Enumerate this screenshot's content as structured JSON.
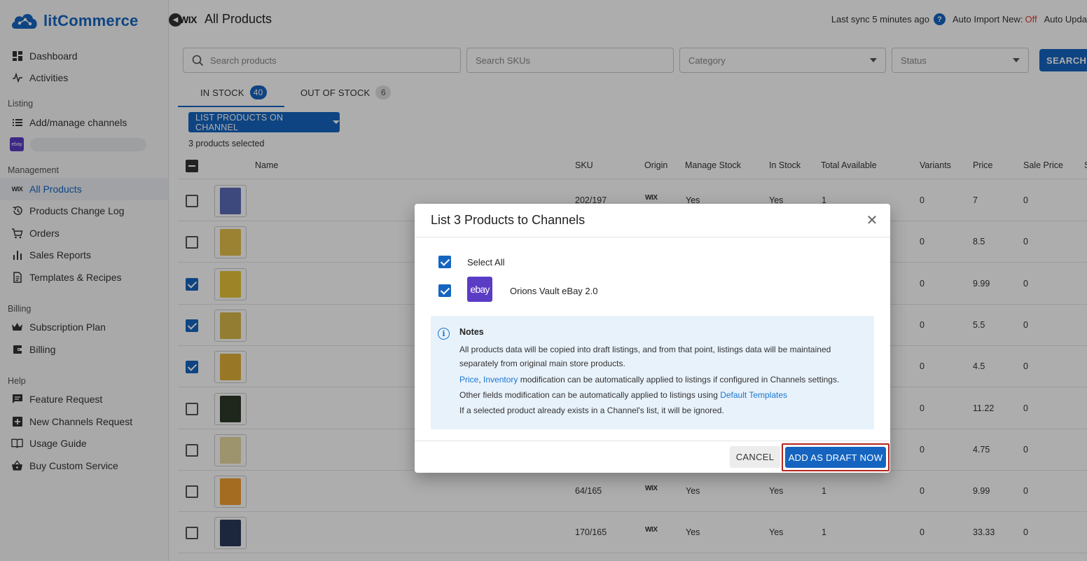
{
  "app": {
    "name": "litCommerce"
  },
  "sidebar": {
    "items_top": [
      {
        "label": "Dashboard",
        "icon": "dashboard-icon"
      },
      {
        "label": "Activities",
        "icon": "activity-icon"
      }
    ],
    "section_listing": "Listing",
    "listing_items": [
      {
        "label": "Add/manage channels",
        "icon": "list-icon"
      }
    ],
    "ebay_channel_mini": "ebay",
    "section_management": "Management",
    "management_items": [
      {
        "label": "All Products",
        "icon": "wix-icon",
        "active": true
      },
      {
        "label": "Products Change Log",
        "icon": "history-icon"
      },
      {
        "label": "Orders",
        "icon": "cart-icon"
      },
      {
        "label": "Sales Reports",
        "icon": "bar-chart-icon"
      },
      {
        "label": "Templates & Recipes",
        "icon": "document-icon"
      }
    ],
    "section_billing": "Billing",
    "billing_items": [
      {
        "label": "Subscription Plan",
        "icon": "crown-icon"
      },
      {
        "label": "Billing",
        "icon": "wallet-icon"
      }
    ],
    "section_help": "Help",
    "help_items": [
      {
        "label": "Feature Request",
        "icon": "feedback-icon"
      },
      {
        "label": "New Channels Request",
        "icon": "add-box-icon"
      },
      {
        "label": "Usage Guide",
        "icon": "book-icon"
      },
      {
        "label": "Buy Custom Service",
        "icon": "basket-icon"
      }
    ]
  },
  "header": {
    "store_logo": "WIX",
    "title": "All Products",
    "last_sync": "Last sync 5 minutes ago",
    "auto_import_label": "Auto Import New:",
    "auto_import_value": "Off",
    "auto_update_label": "Auto Upda"
  },
  "filters": {
    "search_placeholder": "Search products",
    "sku_placeholder": "Search SKUs",
    "category_placeholder": "Category",
    "status_placeholder": "Status",
    "search_button": "SEARCH"
  },
  "tabs": [
    {
      "label": "IN STOCK",
      "count": "40"
    },
    {
      "label": "OUT OF STOCK",
      "count": "6"
    }
  ],
  "list_button": "LIST PRODUCTS ON CHANNEL",
  "selected_text": "3 products selected",
  "table": {
    "columns": [
      "Name",
      "SKU",
      "Origin",
      "Manage Stock",
      "In Stock",
      "Total Available",
      "Variants",
      "Price",
      "Sale Price",
      "S"
    ],
    "rows": [
      {
        "checked": false,
        "sku": "202/197",
        "origin": "WIX",
        "manage_stock": "Yes",
        "in_stock": "Yes",
        "total": "1",
        "variants": "0",
        "price": "7",
        "sale": "0"
      },
      {
        "checked": false,
        "sku": "",
        "origin": "",
        "manage_stock": "",
        "in_stock": "",
        "total": "",
        "variants": "0",
        "price": "8.5",
        "sale": "0"
      },
      {
        "checked": true,
        "sku": "",
        "origin": "",
        "manage_stock": "",
        "in_stock": "",
        "total": "",
        "variants": "0",
        "price": "9.99",
        "sale": "0"
      },
      {
        "checked": true,
        "sku": "",
        "origin": "",
        "manage_stock": "",
        "in_stock": "",
        "total": "",
        "variants": "0",
        "price": "5.5",
        "sale": "0"
      },
      {
        "checked": true,
        "sku": "",
        "origin": "",
        "manage_stock": "",
        "in_stock": "",
        "total": "",
        "variants": "0",
        "price": "4.5",
        "sale": "0"
      },
      {
        "checked": false,
        "sku": "",
        "origin": "",
        "manage_stock": "",
        "in_stock": "",
        "total": "",
        "variants": "0",
        "price": "11.22",
        "sale": "0"
      },
      {
        "checked": false,
        "sku": "",
        "origin": "",
        "manage_stock": "",
        "in_stock": "",
        "total": "",
        "variants": "0",
        "price": "4.75",
        "sale": "0"
      },
      {
        "checked": false,
        "sku": "64/165",
        "origin": "WIX",
        "manage_stock": "Yes",
        "in_stock": "Yes",
        "total": "1",
        "variants": "0",
        "price": "9.99",
        "sale": "0"
      },
      {
        "checked": false,
        "sku": "170/165",
        "origin": "WIX",
        "manage_stock": "Yes",
        "in_stock": "Yes",
        "total": "1",
        "variants": "0",
        "price": "33.33",
        "sale": "0"
      }
    ]
  },
  "dialog": {
    "title": "List 3 Products to Channels",
    "select_all": "Select All",
    "channel_logo": "ebay",
    "channel_name": "Orions Vault eBay 2.0",
    "notes_title": "Notes",
    "note1a": "All products data will be copied into draft listings, and from that point, listings data will be maintained",
    "note1b": "separately from original main store products.",
    "note2_link1": "Price",
    "note2_sep": ", ",
    "note2_link2": "Inventory",
    "note2_rest": " modification can be automatically applied to listings if configured in Channels settings.",
    "note3_text": "Other fields modification can be automatically applied to listings using ",
    "note3_link": "Default Templates",
    "note4": "If a selected product already exists in a Channel's list, it will be ignored.",
    "cancel": "CANCEL",
    "confirm": "ADD AS DRAFT NOW"
  },
  "colors": {
    "primary": "#1565c0",
    "ebay": "#5b3cc4",
    "off": "#e53935",
    "highlight_border": "#b3261e"
  }
}
